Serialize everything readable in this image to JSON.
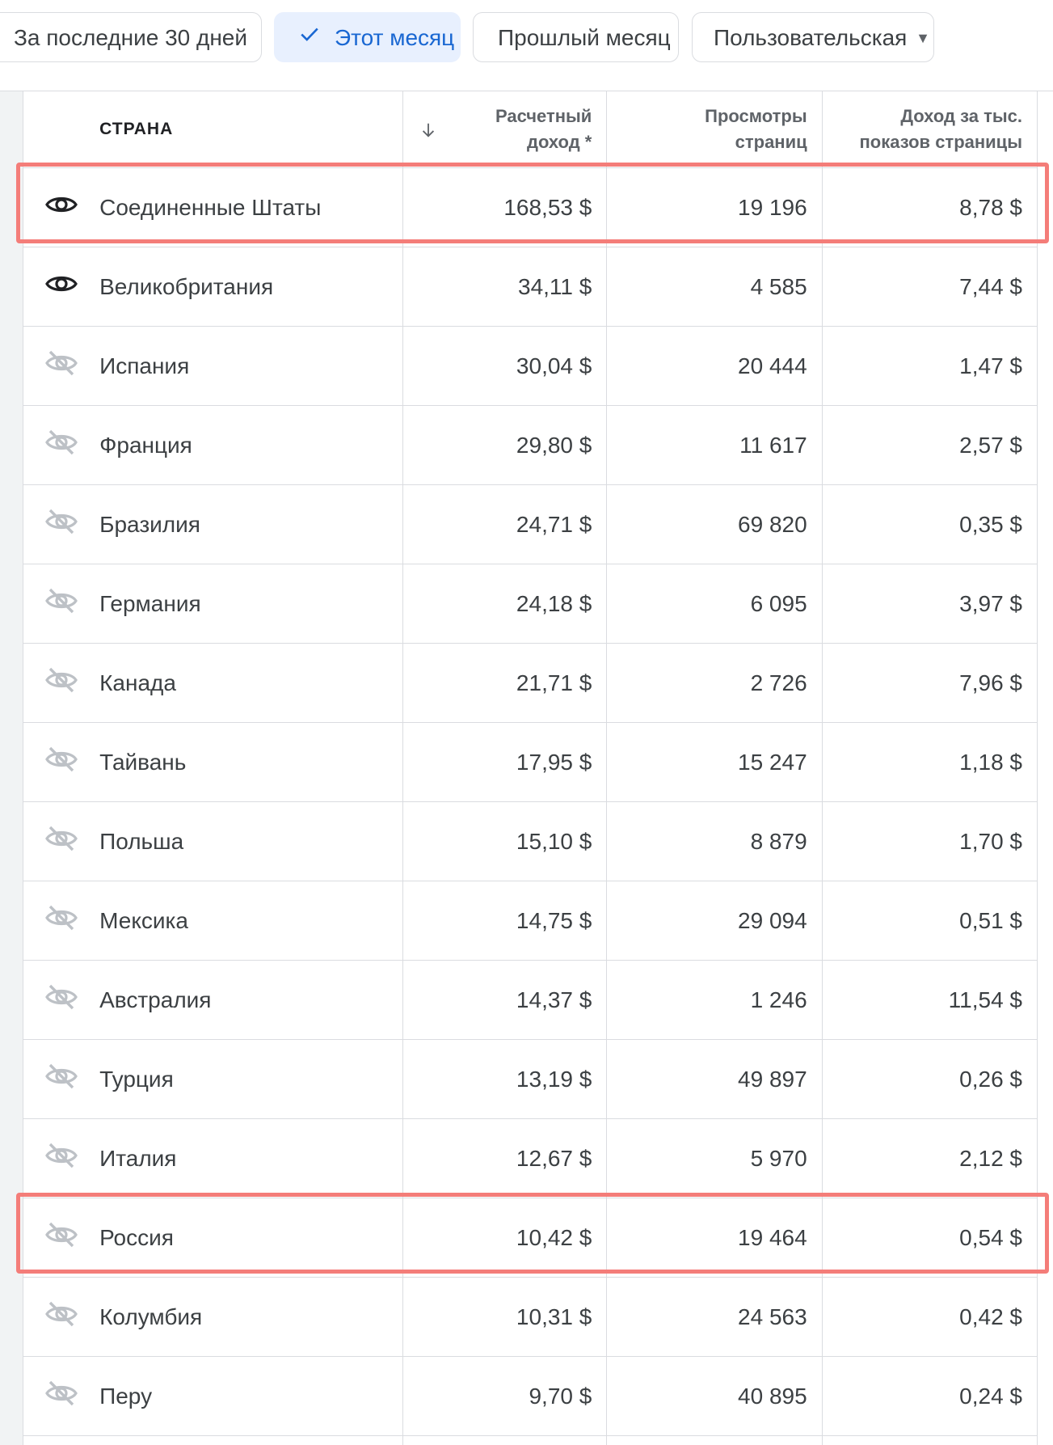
{
  "filters": [
    {
      "label": "За последние 30 дней",
      "selected": false
    },
    {
      "label": "Этот месяц",
      "selected": true
    },
    {
      "label": "Прошлый месяц",
      "selected": false
    },
    {
      "label": "Пользовательская",
      "selected": false
    }
  ],
  "table": {
    "headers": {
      "country": "СТРАНА",
      "revenue_line1": "Расчетный",
      "revenue_line2": "доход *",
      "views_line1": "Просмотры",
      "views_line2": "страниц",
      "rpm_line1": "Доход за тыс.",
      "rpm_line2": "показов страницы"
    },
    "rows": [
      {
        "visible": true,
        "country": "Соединенные Штаты",
        "revenue": "168,53 $",
        "views": "19 196",
        "rpm": "8,78 $",
        "highlighted": true
      },
      {
        "visible": true,
        "country": "Великобритания",
        "revenue": "34,11 $",
        "views": "4 585",
        "rpm": "7,44 $",
        "highlighted": false
      },
      {
        "visible": false,
        "country": "Испания",
        "revenue": "30,04 $",
        "views": "20 444",
        "rpm": "1,47 $",
        "highlighted": false
      },
      {
        "visible": false,
        "country": "Франция",
        "revenue": "29,80 $",
        "views": "11 617",
        "rpm": "2,57 $",
        "highlighted": false
      },
      {
        "visible": false,
        "country": "Бразилия",
        "revenue": "24,71 $",
        "views": "69 820",
        "rpm": "0,35 $",
        "highlighted": false
      },
      {
        "visible": false,
        "country": "Германия",
        "revenue": "24,18 $",
        "views": "6 095",
        "rpm": "3,97 $",
        "highlighted": false
      },
      {
        "visible": false,
        "country": "Канада",
        "revenue": "21,71 $",
        "views": "2 726",
        "rpm": "7,96 $",
        "highlighted": false
      },
      {
        "visible": false,
        "country": "Тайвань",
        "revenue": "17,95 $",
        "views": "15 247",
        "rpm": "1,18 $",
        "highlighted": false
      },
      {
        "visible": false,
        "country": "Польша",
        "revenue": "15,10 $",
        "views": "8 879",
        "rpm": "1,70 $",
        "highlighted": false
      },
      {
        "visible": false,
        "country": "Мексика",
        "revenue": "14,75 $",
        "views": "29 094",
        "rpm": "0,51 $",
        "highlighted": false
      },
      {
        "visible": false,
        "country": "Австралия",
        "revenue": "14,37 $",
        "views": "1 246",
        "rpm": "11,54 $",
        "highlighted": false
      },
      {
        "visible": false,
        "country": "Турция",
        "revenue": "13,19 $",
        "views": "49 897",
        "rpm": "0,26 $",
        "highlighted": false
      },
      {
        "visible": false,
        "country": "Италия",
        "revenue": "12,67 $",
        "views": "5 970",
        "rpm": "2,12 $",
        "highlighted": false
      },
      {
        "visible": false,
        "country": "Россия",
        "revenue": "10,42 $",
        "views": "19 464",
        "rpm": "0,54 $",
        "highlighted": true
      },
      {
        "visible": false,
        "country": "Колумбия",
        "revenue": "10,31 $",
        "views": "24 563",
        "rpm": "0,42 $",
        "highlighted": false
      },
      {
        "visible": false,
        "country": "Перу",
        "revenue": "9,70 $",
        "views": "40 895",
        "rpm": "0,24 $",
        "highlighted": false
      },
      {
        "visible": false,
        "country": "",
        "revenue": "",
        "views": "",
        "rpm": "",
        "highlighted": false
      }
    ]
  },
  "colors": {
    "selected_chip_bg": "#e8f0fe",
    "selected_chip_text": "#1967d2",
    "highlight_border": "#f47d79",
    "icon_visible": "#202124",
    "icon_hidden": "#bdc1c6"
  },
  "icons": {
    "check": "check-icon",
    "visible": "eye-icon",
    "hidden": "eye-off-icon",
    "sort": "arrow-down-icon",
    "dropdown": "caret-down-icon"
  }
}
